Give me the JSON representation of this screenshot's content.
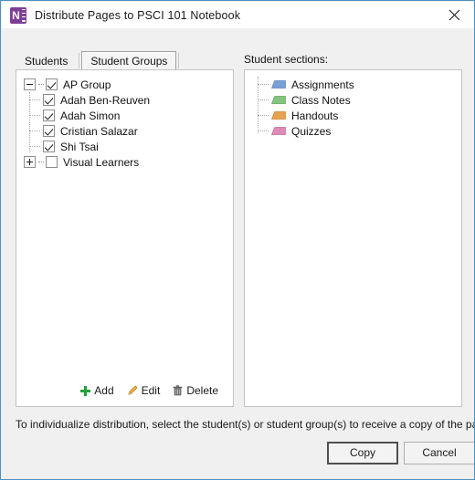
{
  "window": {
    "title": "Distribute Pages to PSCI 101 Notebook",
    "app_icon": "onenote-icon",
    "app_icon_letter": "N",
    "close_icon": "close-icon",
    "border_color": "#4a90c2"
  },
  "tabs": [
    {
      "label": "Students",
      "selected": false
    },
    {
      "label": "Student Groups",
      "selected": true
    }
  ],
  "groups_tree": {
    "roots": [
      {
        "label": "AP Group",
        "expander": "minus",
        "checked": true,
        "children": [
          {
            "label": "Adah Ben-Reuven",
            "checked": true
          },
          {
            "label": "Adah Simon",
            "checked": true
          },
          {
            "label": "Cristian Salazar",
            "checked": true
          },
          {
            "label": "Shi Tsai",
            "checked": true
          }
        ]
      },
      {
        "label": "Visual Learners",
        "expander": "plus",
        "checked": false,
        "children": []
      }
    ]
  },
  "group_toolbar": [
    {
      "label": "Add",
      "icon": "plus-icon",
      "color": "#23a03a"
    },
    {
      "label": "Edit",
      "icon": "pencil-icon",
      "color": "#e8a33d"
    },
    {
      "label": "Delete",
      "icon": "trash-icon",
      "color": "#5a5a5a"
    }
  ],
  "sections_panel": {
    "label": "Student sections:",
    "items": [
      {
        "label": "Assignments",
        "color": "#7a9fd4",
        "icon": "section-tab-icon"
      },
      {
        "label": "Class Notes",
        "color": "#82c47e",
        "icon": "section-tab-icon"
      },
      {
        "label": "Handouts",
        "color": "#e8a24f",
        "icon": "section-tab-icon"
      },
      {
        "label": "Quizzes",
        "color": "#e08ab8",
        "icon": "section-tab-icon"
      }
    ]
  },
  "footer": {
    "hint": "To individualize distribution, select the student(s) or student group(s) to receive a copy of the page.",
    "copy_label": "Copy",
    "cancel_label": "Cancel"
  }
}
